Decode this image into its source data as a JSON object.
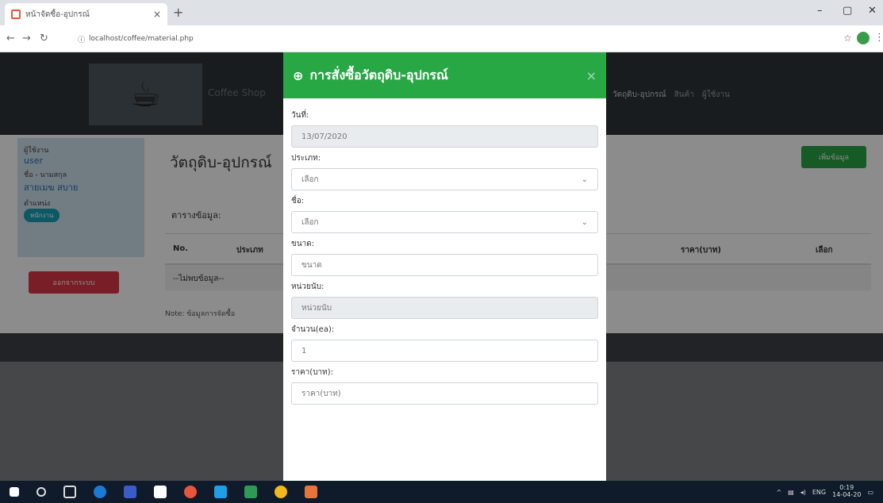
{
  "browser": {
    "tab_title": "หน้าจัดซื้อ-อุปกรณ์",
    "tab_close": "×",
    "new_tab": "+",
    "url_info": "ⓘ",
    "url": "localhost/coffee/material.php",
    "win_min": "–",
    "win_max": "▢",
    "win_close": "✕"
  },
  "navbar": {
    "brand": "Coffee Shop",
    "links": [
      "วัตถุดิบ-อุปกรณ์",
      "สินค้า",
      "ผู้ใช้งาน"
    ]
  },
  "sidebar": {
    "user_label": "ผู้ใช้งาน",
    "user_value": "user",
    "name_label": "ชื่อ - นามสกุล",
    "name_value": "สายเมฆ สบาย",
    "role_label": "ตำแหน่ง",
    "role_badge": "พนักงาน",
    "logout": "ออกจากระบบ"
  },
  "content": {
    "title": "วัตถุดิบ-อุปกรณ์",
    "add_button": "เพิ่มข้อมูล",
    "table_label": "ตารางข้อมูล:",
    "columns": [
      "No.",
      "ประเภท",
      "ราคา(บาท)",
      "เลือก"
    ],
    "empty_row": "--ไม่พบข้อมูล--",
    "note": "Note: ข้อมูลการจัดซื้อ"
  },
  "modal": {
    "title": "การสั่งซื้อวัตถุดิบ-อุปกรณ์",
    "close": "×",
    "date_label": "วันที่:",
    "date_value": "13/07/2020",
    "type_label": "ประเภท:",
    "type_value": "เลือก",
    "name_label": "ชื่อ:",
    "name_value": "เลือก",
    "size_label": "ขนาด:",
    "size_placeholder": "ขนาด",
    "unit_label": "หน่วยนับ:",
    "unit_placeholder": "หน่วยนับ",
    "qty_label": "จำนวน(ea):",
    "qty_value": "1",
    "price_label": "ราคา(บาท):",
    "price_placeholder": "ราคา(บาท)"
  },
  "taskbar": {
    "lang": "ENG",
    "time": "0:19",
    "date": "14-04-20"
  }
}
